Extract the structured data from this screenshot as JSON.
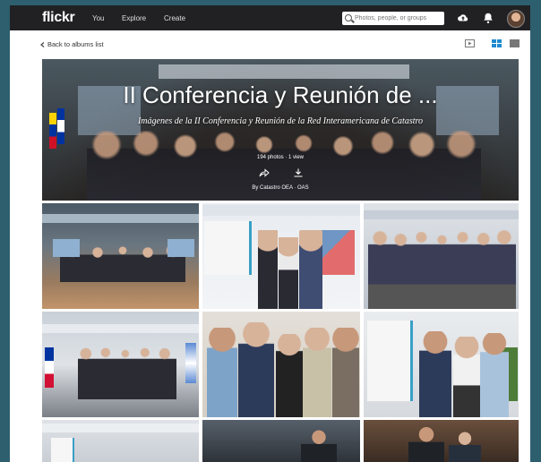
{
  "topbar": {
    "logo": "flickr",
    "nav": [
      "You",
      "Explore",
      "Create"
    ],
    "search_placeholder": "Photos, people, or groups"
  },
  "icons": {
    "search": "search-icon",
    "upload": "cloud-upload-icon",
    "notifications": "bell-icon",
    "avatar": "avatar",
    "back": "chevron-left-icon",
    "slideshow": "slideshow-icon",
    "grid": "grid-icon",
    "list": "list-icon",
    "share": "share-icon",
    "download": "download-icon"
  },
  "subbar": {
    "back_label": "Back to albums list"
  },
  "album": {
    "title": "II Conferencia y Reunión de ...",
    "subtitle": "Imágenes de la II Conferencia y Reunión de la Red Interamericana de Catastro",
    "stats": "194 photos  ·  1 view",
    "by": "By Catastro OEA · OAS"
  },
  "colors": {
    "page_bg": "#2d5f6e",
    "topbar_bg": "#212124",
    "accent_blue": "#1f8ad1"
  },
  "photos": [
    "group-photo-hall",
    "two-men-certificate",
    "group-photo-banner",
    "group-photo-flags",
    "five-people-standing",
    "four-people-standing",
    "banner-row-bottom",
    "man-suit-bottom",
    "seated-men-bottom"
  ]
}
